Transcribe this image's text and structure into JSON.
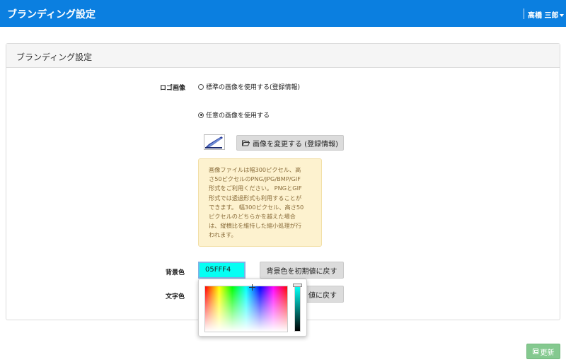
{
  "header": {
    "app_title": "ブランディング設定",
    "user_name": "高橋 三郎"
  },
  "panel": {
    "title": "ブランディング設定"
  },
  "logo": {
    "label": "ロゴ画像",
    "option_default": "標準の画像を使用する(登録情報)",
    "option_custom": "任意の画像を使用する",
    "selected_option": "option_custom",
    "change_button": "画像を変更する (登録情報)",
    "note_lines": [
      "画像ファイルは幅300ピクセル、高",
      "さ50ピクセルのPNG/JPG/BMP/GIF",
      "形式をご利用ください。 PNGとGIF",
      "形式では透過形式も利用することが",
      "できます。 幅300ピクセル、高さ50",
      "ピクセルのどちらかを越えた場合",
      "は、縦横比を維持した縮小処理が行",
      "われます。"
    ]
  },
  "background_color": {
    "label": "背景色",
    "value": "05FFF4",
    "reset_button": "背景色を初期値に戻す"
  },
  "text_color": {
    "label": "文字色",
    "reset_button_visible": "値に戻す"
  },
  "footer": {
    "save_button": "更新"
  },
  "colors": {
    "header_bg": "#0b7fe0",
    "bg_color_value": "#05fff4",
    "save_button": "#84c98f",
    "note_bg": "#fdf2cf"
  }
}
